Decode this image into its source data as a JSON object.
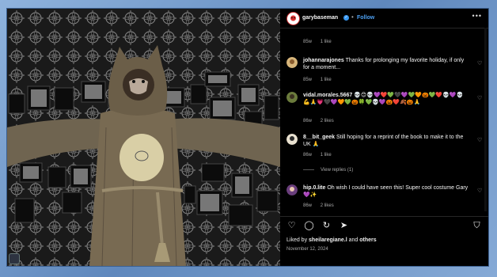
{
  "post": {
    "username": "garybaseman",
    "verified_glyph": "✓",
    "dot": "•",
    "follow_label": "Follow",
    "more_glyph": "•••"
  },
  "top_meta": {
    "age": "85w",
    "likes": "1 like"
  },
  "comments": [
    {
      "user": "johannarajones",
      "text": "Thanks for prolonging my favorite holiday, if only for a moment...",
      "age": "85w",
      "likes": "1 like",
      "reply": ""
    },
    {
      "user": "vidal.morales.5667",
      "text": "💀😊💀💜❤️💚🖤💜💚🧡🎃💚❤️💀💜💀💪🙏💗🖤💜🧡💚🎃🍀💚💀💜🎃❤️🍂🎃🙏",
      "age": "86w",
      "likes": "2 likes",
      "reply": ""
    },
    {
      "user": "8__bit_geek",
      "text": "Still hoping for a reprint of the book to make it to the UK 🙏",
      "age": "86w",
      "likes": "1 like",
      "reply": "View replies (1)"
    },
    {
      "user": "hip.0.lite",
      "text": "Oh wish I could have seen this! Super cool costume Gary 💜✨",
      "age": "86w",
      "likes": "2 likes",
      "reply": ""
    }
  ],
  "liked_by": {
    "prefix": "Liked by ",
    "user": "sheilaregiane.l",
    "suffix": " and ",
    "others": "others"
  },
  "date": "November 12, 2024",
  "icons": {
    "heart": "♡",
    "comment": "◯",
    "repost": "↻",
    "share": "➤",
    "save": "⛉"
  }
}
